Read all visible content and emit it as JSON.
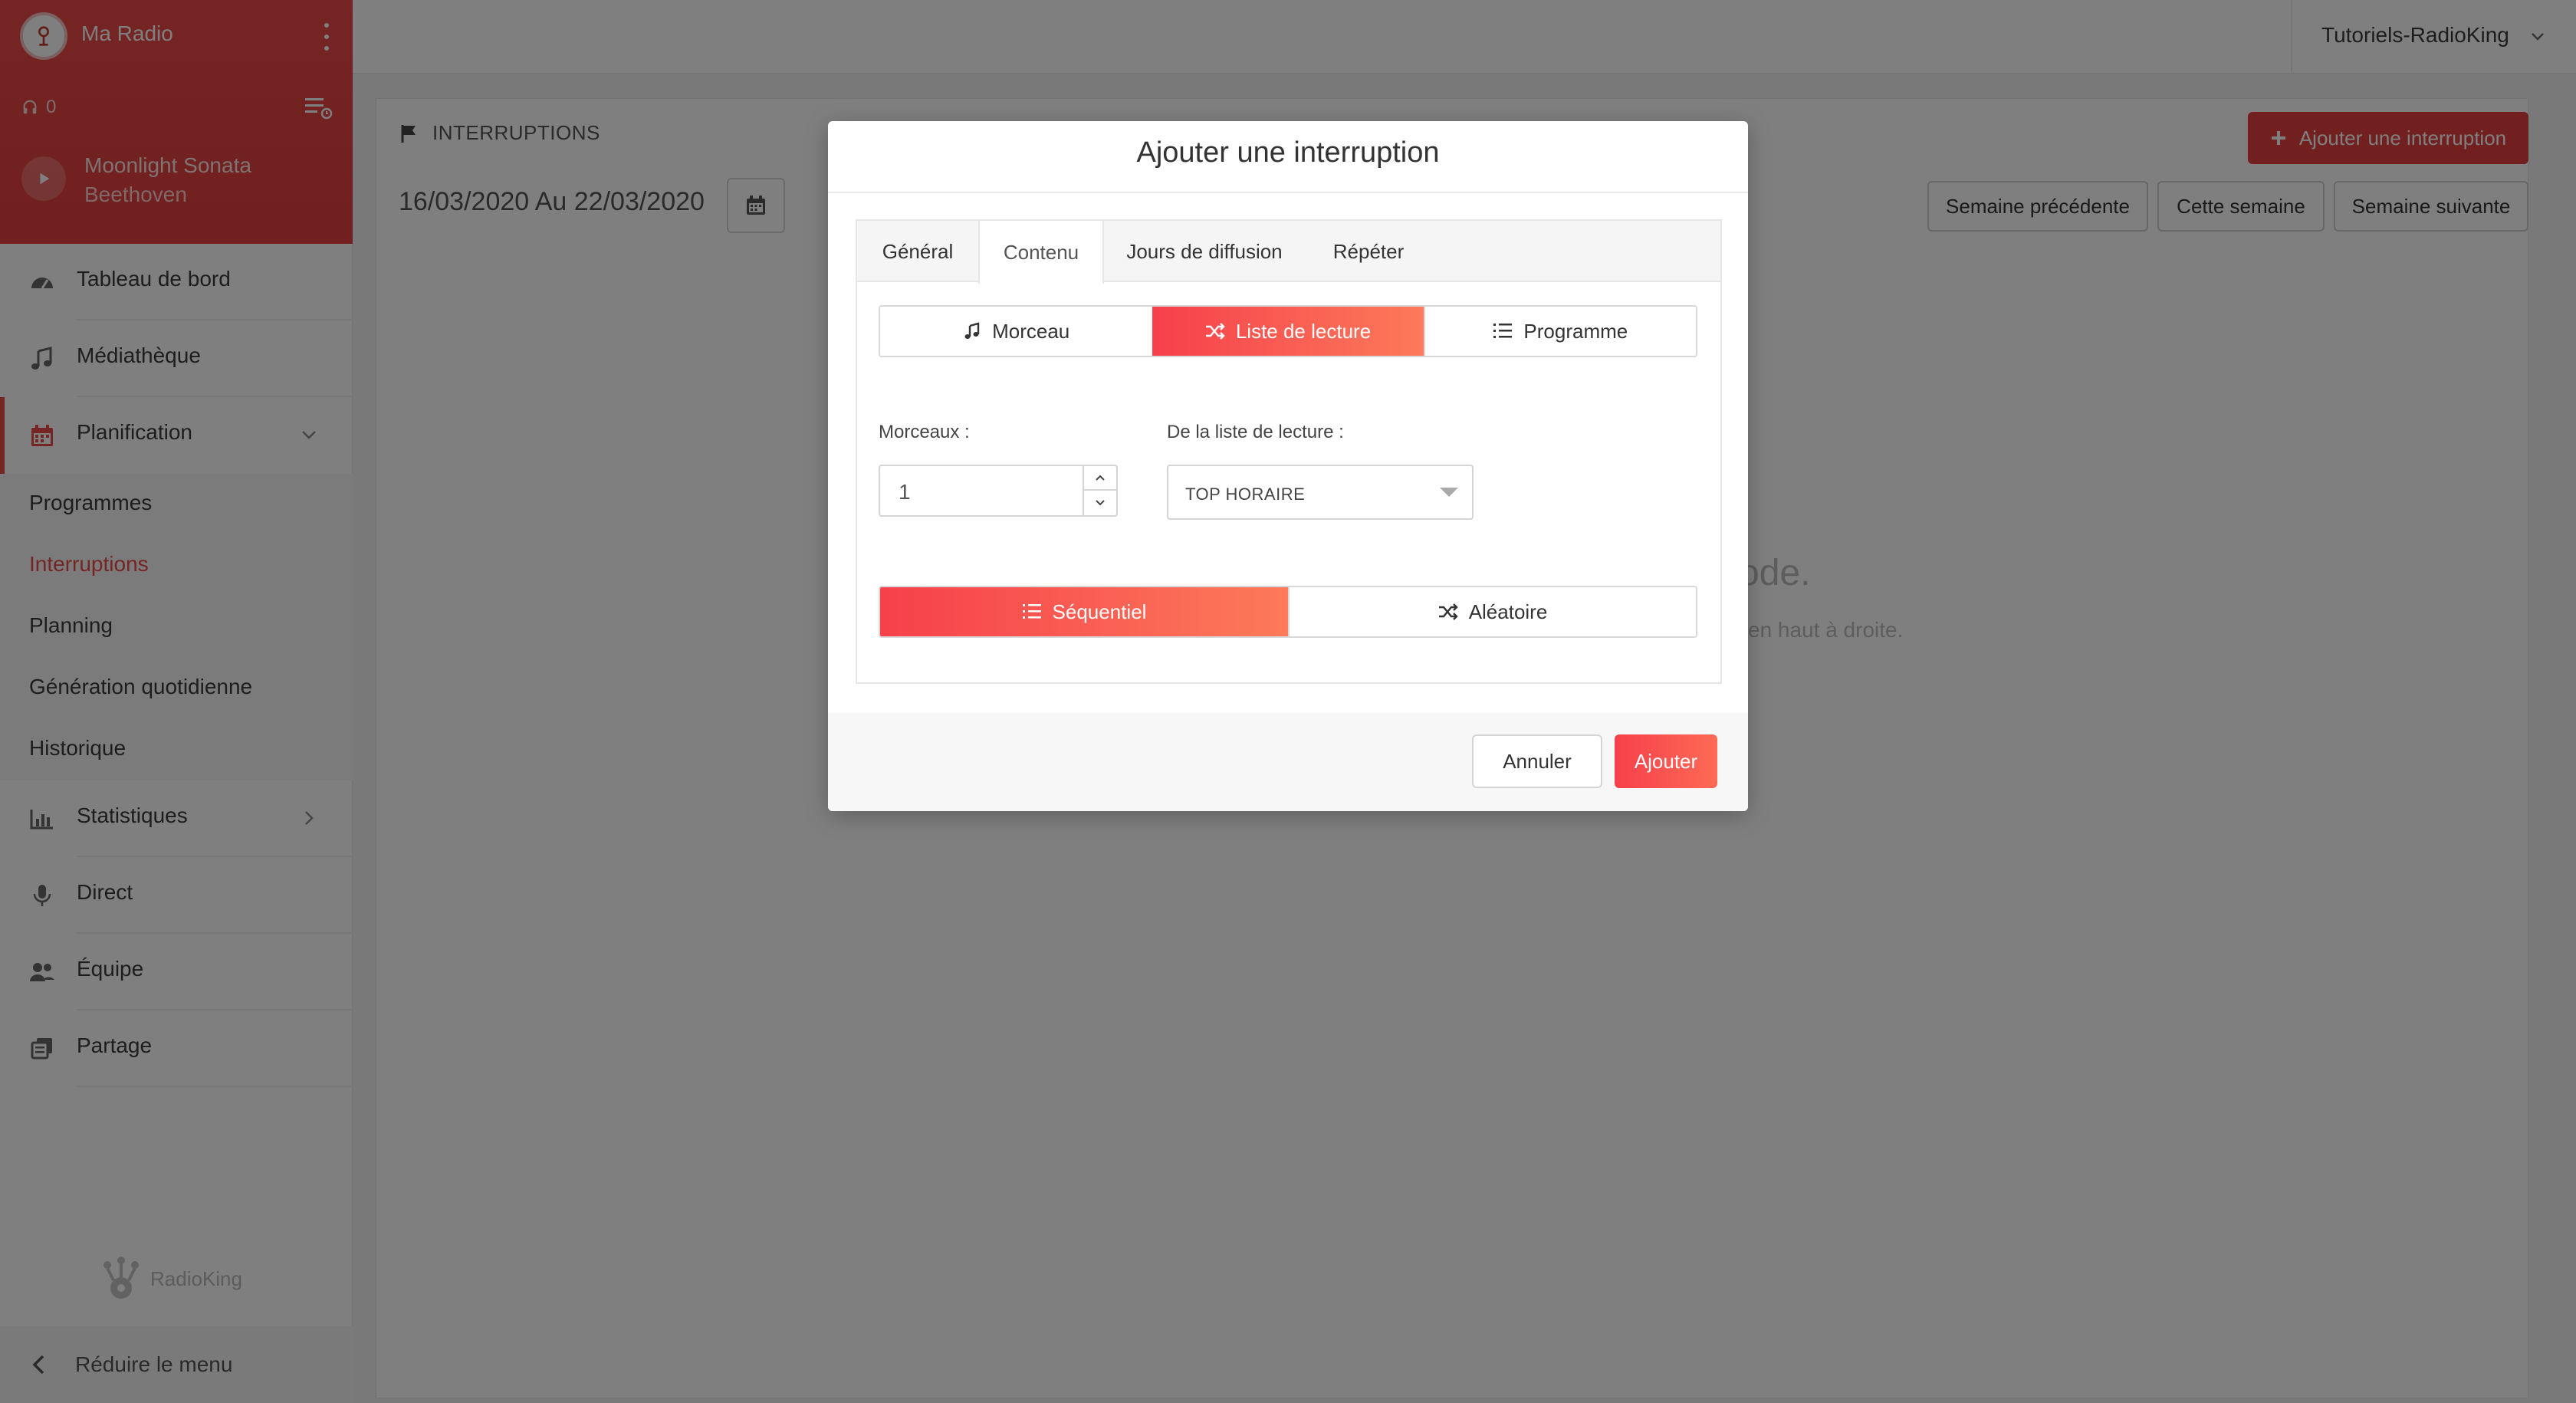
{
  "app": {
    "radio_name": "Ma Radio",
    "listeners": "0",
    "now_playing": {
      "track": "Moonlight Sonata",
      "artist": "Beethoven"
    }
  },
  "sidebar": {
    "items": [
      {
        "label": "Tableau de bord",
        "icon": "dashboard-icon"
      },
      {
        "label": "Médiathèque",
        "icon": "music-note-icon"
      },
      {
        "label": "Planification",
        "icon": "calendar-icon"
      },
      {
        "label": "Statistiques",
        "icon": "bar-chart-icon"
      },
      {
        "label": "Direct",
        "icon": "microphone-icon"
      },
      {
        "label": "Équipe",
        "icon": "users-icon"
      },
      {
        "label": "Partage",
        "icon": "share-icon"
      }
    ],
    "subitems": [
      {
        "label": "Programmes"
      },
      {
        "label": "Interruptions"
      },
      {
        "label": "Planning"
      },
      {
        "label": "Génération quotidienne"
      },
      {
        "label": "Historique"
      }
    ],
    "brand": "RadioKing",
    "collapse_label": "Réduire le menu"
  },
  "topbar": {
    "user": "Tutoriels-RadioKing"
  },
  "page": {
    "title": "INTERRUPTIONS",
    "date_range": "16/03/2020 Au 22/03/2020",
    "add_button": "Ajouter une interruption",
    "week_buttons": [
      "Semaine précédente",
      "Cette semaine",
      "Semaine suivante"
    ],
    "empty_line1": "ode.",
    "empty_line2": "en haut à droite."
  },
  "modal": {
    "title": "Ajouter une interruption",
    "tabs": [
      "Général",
      "Contenu",
      "Jours de diffusion",
      "Répéter"
    ],
    "active_tab": "Contenu",
    "content_types": [
      "Morceau",
      "Liste de lecture",
      "Programme"
    ],
    "selected_content_type": "Liste de lecture",
    "tracks_label": "Morceaux :",
    "tracks_value": "1",
    "playlist_label": "De la liste de lecture :",
    "playlist_value": "TOP HORAIRE",
    "order_modes": [
      "Séquentiel",
      "Aléatoire"
    ],
    "selected_order_mode": "Séquentiel",
    "cancel_label": "Annuler",
    "submit_label": "Ajouter"
  },
  "colors": {
    "accent": "#ea4a48",
    "gradient_start": "#f6404b",
    "gradient_end": "#fd7a5a"
  }
}
